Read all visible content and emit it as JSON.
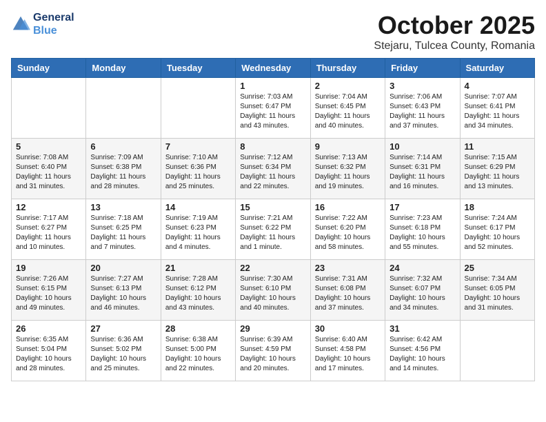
{
  "header": {
    "logo_line1": "General",
    "logo_line2": "Blue",
    "month": "October 2025",
    "location": "Stejaru, Tulcea County, Romania"
  },
  "weekdays": [
    "Sunday",
    "Monday",
    "Tuesday",
    "Wednesday",
    "Thursday",
    "Friday",
    "Saturday"
  ],
  "weeks": [
    [
      {
        "day": "",
        "info": ""
      },
      {
        "day": "",
        "info": ""
      },
      {
        "day": "",
        "info": ""
      },
      {
        "day": "1",
        "info": "Sunrise: 7:03 AM\nSunset: 6:47 PM\nDaylight: 11 hours\nand 43 minutes."
      },
      {
        "day": "2",
        "info": "Sunrise: 7:04 AM\nSunset: 6:45 PM\nDaylight: 11 hours\nand 40 minutes."
      },
      {
        "day": "3",
        "info": "Sunrise: 7:06 AM\nSunset: 6:43 PM\nDaylight: 11 hours\nand 37 minutes."
      },
      {
        "day": "4",
        "info": "Sunrise: 7:07 AM\nSunset: 6:41 PM\nDaylight: 11 hours\nand 34 minutes."
      }
    ],
    [
      {
        "day": "5",
        "info": "Sunrise: 7:08 AM\nSunset: 6:40 PM\nDaylight: 11 hours\nand 31 minutes."
      },
      {
        "day": "6",
        "info": "Sunrise: 7:09 AM\nSunset: 6:38 PM\nDaylight: 11 hours\nand 28 minutes."
      },
      {
        "day": "7",
        "info": "Sunrise: 7:10 AM\nSunset: 6:36 PM\nDaylight: 11 hours\nand 25 minutes."
      },
      {
        "day": "8",
        "info": "Sunrise: 7:12 AM\nSunset: 6:34 PM\nDaylight: 11 hours\nand 22 minutes."
      },
      {
        "day": "9",
        "info": "Sunrise: 7:13 AM\nSunset: 6:32 PM\nDaylight: 11 hours\nand 19 minutes."
      },
      {
        "day": "10",
        "info": "Sunrise: 7:14 AM\nSunset: 6:31 PM\nDaylight: 11 hours\nand 16 minutes."
      },
      {
        "day": "11",
        "info": "Sunrise: 7:15 AM\nSunset: 6:29 PM\nDaylight: 11 hours\nand 13 minutes."
      }
    ],
    [
      {
        "day": "12",
        "info": "Sunrise: 7:17 AM\nSunset: 6:27 PM\nDaylight: 11 hours\nand 10 minutes."
      },
      {
        "day": "13",
        "info": "Sunrise: 7:18 AM\nSunset: 6:25 PM\nDaylight: 11 hours\nand 7 minutes."
      },
      {
        "day": "14",
        "info": "Sunrise: 7:19 AM\nSunset: 6:23 PM\nDaylight: 11 hours\nand 4 minutes."
      },
      {
        "day": "15",
        "info": "Sunrise: 7:21 AM\nSunset: 6:22 PM\nDaylight: 11 hours\nand 1 minute."
      },
      {
        "day": "16",
        "info": "Sunrise: 7:22 AM\nSunset: 6:20 PM\nDaylight: 10 hours\nand 58 minutes."
      },
      {
        "day": "17",
        "info": "Sunrise: 7:23 AM\nSunset: 6:18 PM\nDaylight: 10 hours\nand 55 minutes."
      },
      {
        "day": "18",
        "info": "Sunrise: 7:24 AM\nSunset: 6:17 PM\nDaylight: 10 hours\nand 52 minutes."
      }
    ],
    [
      {
        "day": "19",
        "info": "Sunrise: 7:26 AM\nSunset: 6:15 PM\nDaylight: 10 hours\nand 49 minutes."
      },
      {
        "day": "20",
        "info": "Sunrise: 7:27 AM\nSunset: 6:13 PM\nDaylight: 10 hours\nand 46 minutes."
      },
      {
        "day": "21",
        "info": "Sunrise: 7:28 AM\nSunset: 6:12 PM\nDaylight: 10 hours\nand 43 minutes."
      },
      {
        "day": "22",
        "info": "Sunrise: 7:30 AM\nSunset: 6:10 PM\nDaylight: 10 hours\nand 40 minutes."
      },
      {
        "day": "23",
        "info": "Sunrise: 7:31 AM\nSunset: 6:08 PM\nDaylight: 10 hours\nand 37 minutes."
      },
      {
        "day": "24",
        "info": "Sunrise: 7:32 AM\nSunset: 6:07 PM\nDaylight: 10 hours\nand 34 minutes."
      },
      {
        "day": "25",
        "info": "Sunrise: 7:34 AM\nSunset: 6:05 PM\nDaylight: 10 hours\nand 31 minutes."
      }
    ],
    [
      {
        "day": "26",
        "info": "Sunrise: 6:35 AM\nSunset: 5:04 PM\nDaylight: 10 hours\nand 28 minutes."
      },
      {
        "day": "27",
        "info": "Sunrise: 6:36 AM\nSunset: 5:02 PM\nDaylight: 10 hours\nand 25 minutes."
      },
      {
        "day": "28",
        "info": "Sunrise: 6:38 AM\nSunset: 5:00 PM\nDaylight: 10 hours\nand 22 minutes."
      },
      {
        "day": "29",
        "info": "Sunrise: 6:39 AM\nSunset: 4:59 PM\nDaylight: 10 hours\nand 20 minutes."
      },
      {
        "day": "30",
        "info": "Sunrise: 6:40 AM\nSunset: 4:58 PM\nDaylight: 10 hours\nand 17 minutes."
      },
      {
        "day": "31",
        "info": "Sunrise: 6:42 AM\nSunset: 4:56 PM\nDaylight: 10 hours\nand 14 minutes."
      },
      {
        "day": "",
        "info": ""
      }
    ]
  ]
}
